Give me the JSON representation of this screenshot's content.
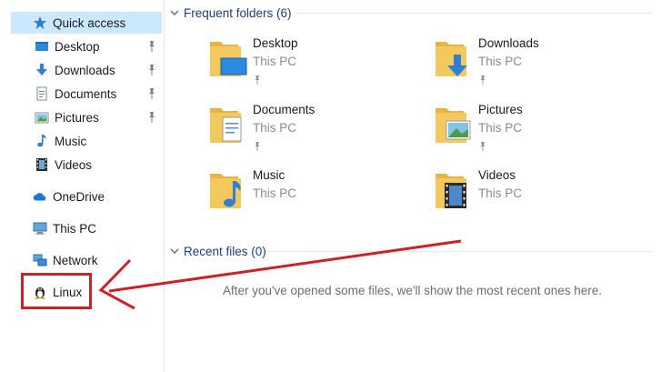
{
  "nav": {
    "quick_access": "Quick access",
    "pinned": [
      {
        "label": "Desktop",
        "icon": "desktop-icon"
      },
      {
        "label": "Downloads",
        "icon": "downloads-icon"
      },
      {
        "label": "Documents",
        "icon": "documents-icon"
      },
      {
        "label": "Pictures",
        "icon": "pictures-icon"
      }
    ],
    "music": "Music",
    "videos": "Videos",
    "onedrive": "OneDrive",
    "this_pc": "This PC",
    "network": "Network",
    "linux": "Linux"
  },
  "frequent": {
    "header": "Frequent folders (6)",
    "items": [
      {
        "name": "Desktop",
        "location": "This PC",
        "icon": "folder-desktop-icon"
      },
      {
        "name": "Downloads",
        "location": "This PC",
        "icon": "folder-downloads-icon"
      },
      {
        "name": "Documents",
        "location": "This PC",
        "icon": "folder-documents-icon"
      },
      {
        "name": "Pictures",
        "location": "This PC",
        "icon": "folder-pictures-icon"
      },
      {
        "name": "Music",
        "location": "This PC",
        "icon": "folder-music-icon"
      },
      {
        "name": "Videos",
        "location": "This PC",
        "icon": "folder-videos-icon"
      }
    ]
  },
  "recent": {
    "header": "Recent files (0)",
    "empty_message": "After you've opened some files, we'll show the most recent ones here."
  },
  "colors": {
    "selection": "#cce8ff",
    "header_text": "#1f3d7a",
    "annotation": "#d11f25",
    "folder": "#f3c95e"
  }
}
